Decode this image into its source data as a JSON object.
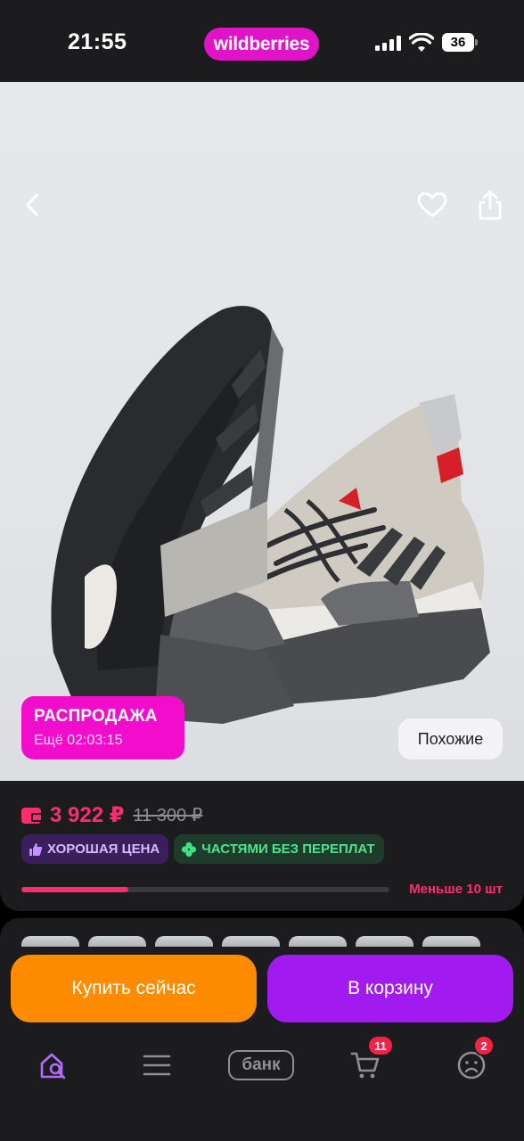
{
  "status_bar": {
    "time": "21:55",
    "brand": "wildberries",
    "battery": "36"
  },
  "hero": {
    "icons": [
      "back-arrow-icon",
      "heart-icon",
      "share-icon"
    ],
    "sale_badge": {
      "title": "РАСПРОДАЖА",
      "timer": "Ещё 02:03:15"
    },
    "similar_label": "Похожие"
  },
  "price": {
    "current": "3 922 ₽",
    "old": "11 300 ₽",
    "accent_color": "#ff2c6e",
    "chips": [
      {
        "label": "ХОРОШАЯ ЦЕНА",
        "icon": "thumbs-up-icon"
      },
      {
        "label": "ЧАСТЯМИ БЕЗ ПЕРЕПЛАТ",
        "icon": "clover-icon"
      }
    ],
    "stock": {
      "label": "Меньше 10 шт",
      "fill_fraction": 0.29
    }
  },
  "actions": {
    "buy_now": "Купить сейчас",
    "add_to_cart": "В корзину",
    "buy_color": "#ff8c00",
    "cart_color": "#a11bf0"
  },
  "tabbar": {
    "items": [
      {
        "name": "home",
        "icon": "home-search-icon",
        "active": true
      },
      {
        "name": "catalog",
        "icon": "menu-icon"
      },
      {
        "name": "bank",
        "label": "банк"
      },
      {
        "name": "cart",
        "icon": "cart-icon",
        "badge": "11"
      },
      {
        "name": "profile",
        "icon": "profile-icon",
        "badge": "2"
      }
    ],
    "active_color": "#b36bff"
  }
}
